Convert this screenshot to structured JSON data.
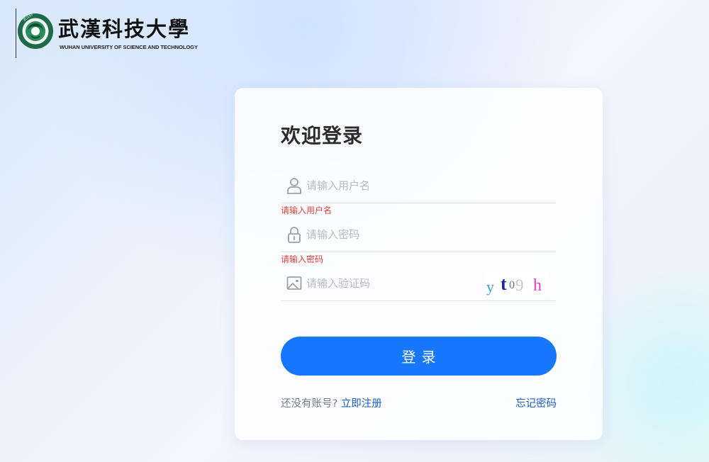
{
  "logo": {
    "name_cn": "武漢科技大學",
    "name_en": "WUHAN UNIVERSITY OF SCIENCE AND TECHNOLOGY",
    "seal_icon": "university-seal-icon"
  },
  "login": {
    "title": "欢迎登录",
    "username": {
      "placeholder": "请输入用户名",
      "value": "",
      "error": "请输入用户名",
      "icon": "user-icon"
    },
    "password": {
      "placeholder": "请输入密码",
      "value": "",
      "error": "请输入密码",
      "icon": "lock-icon"
    },
    "captcha": {
      "placeholder": "请输入验证码",
      "value": "",
      "icon": "image-icon",
      "chars": [
        {
          "ch": "y",
          "color": "#3aa0df"
        },
        {
          "ch": "t",
          "color": "#1a2a9a"
        },
        {
          "ch": "0",
          "color": "#5a7a8a"
        },
        {
          "ch": "9",
          "color": "#c9c3c7"
        },
        {
          "ch": "h",
          "color": "#e040d0"
        }
      ]
    },
    "submit_label": "登录",
    "no_account_text": "还没有账号?",
    "register_link": "立即注册",
    "forgot_link": "忘记密码"
  },
  "colors": {
    "primary": "#1677ff",
    "error": "#e0413d",
    "link": "#1b5fc9",
    "logo_green": "#1d6b4a"
  }
}
